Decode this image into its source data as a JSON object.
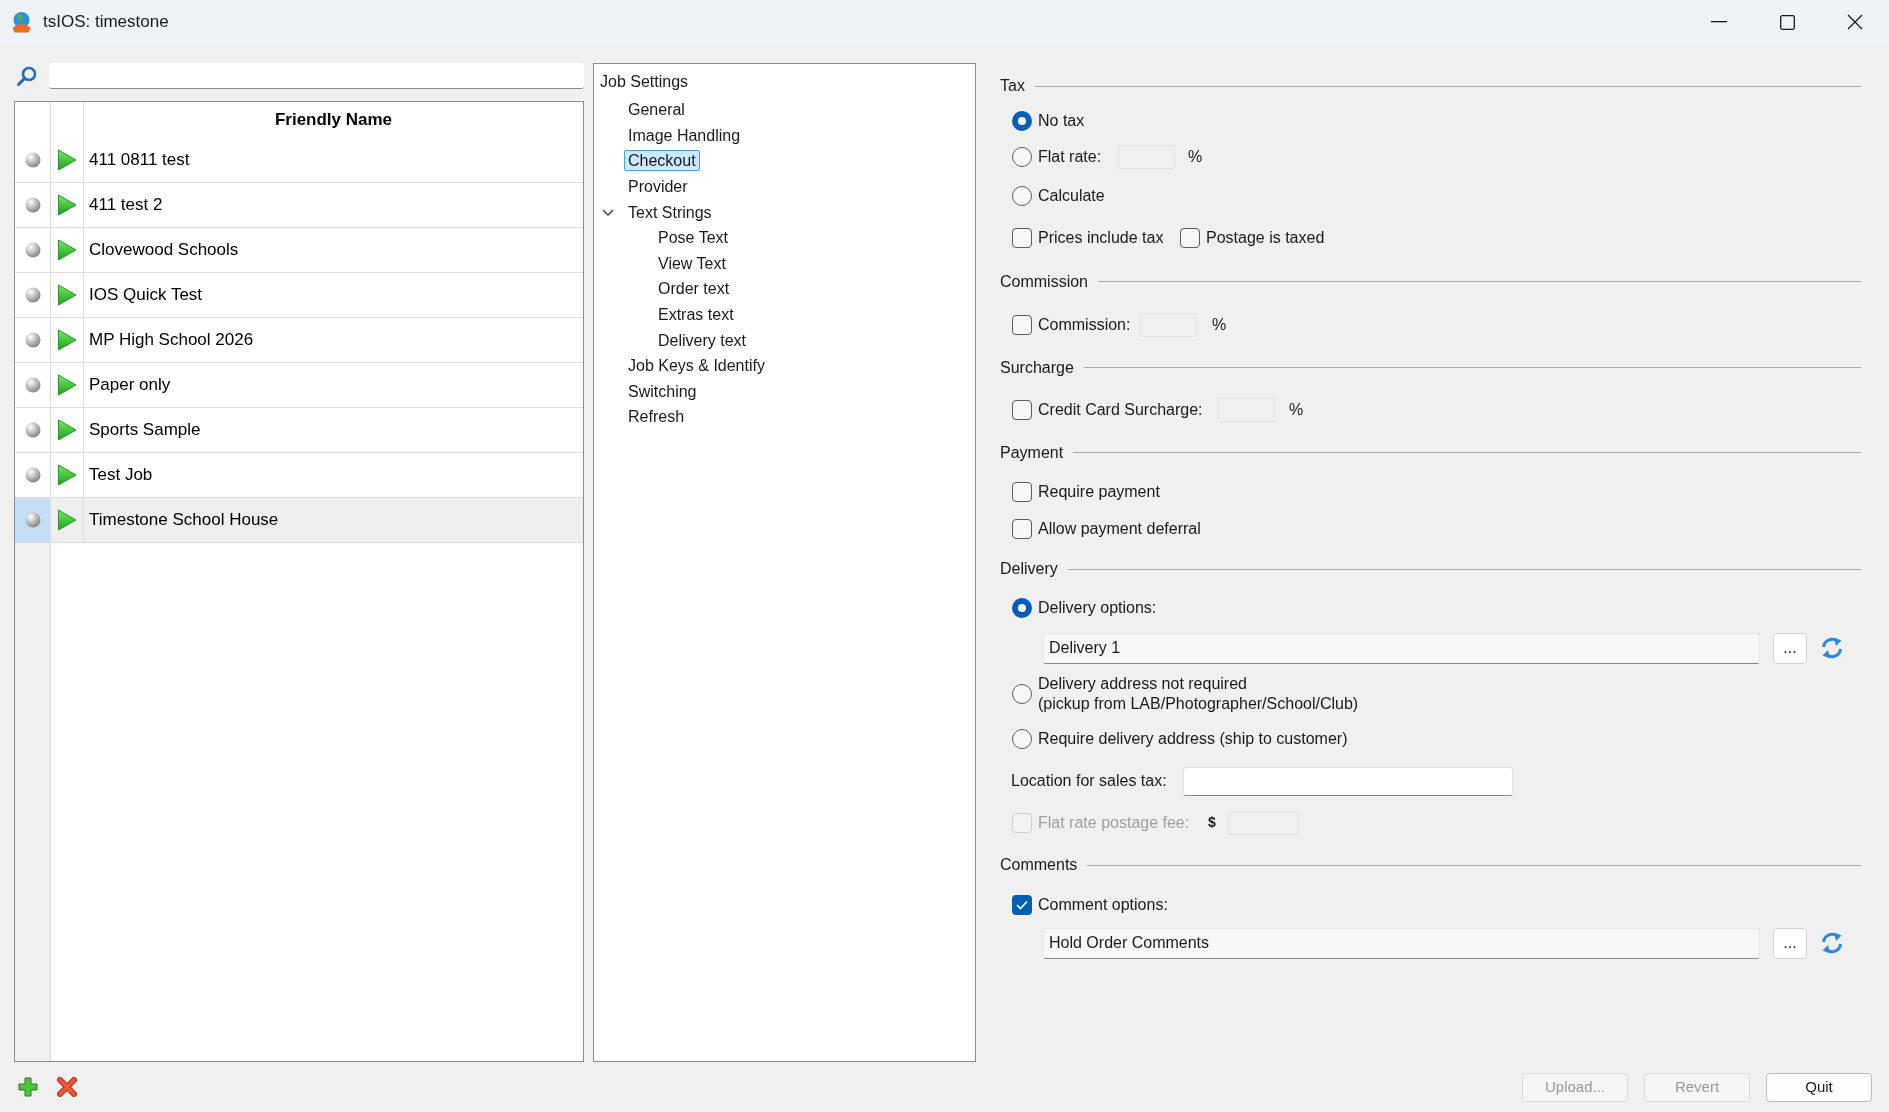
{
  "window": {
    "title": "tsIOS: timestone"
  },
  "jobs": {
    "heading": "Friendly Name",
    "rows": [
      {
        "name": "411 0811 test",
        "selected": false
      },
      {
        "name": "411 test 2",
        "selected": false
      },
      {
        "name": "Clovewood Schools",
        "selected": false
      },
      {
        "name": "IOS Quick Test",
        "selected": false
      },
      {
        "name": "MP High School 2026",
        "selected": false
      },
      {
        "name": "Paper only",
        "selected": false
      },
      {
        "name": "Sports Sample",
        "selected": false
      },
      {
        "name": "Test Job",
        "selected": false
      },
      {
        "name": "Timestone School House",
        "selected": true
      }
    ]
  },
  "settings_tree": {
    "items": [
      {
        "label": "Job Settings",
        "selected": false,
        "children": [
          {
            "label": "General",
            "selected": false
          },
          {
            "label": "Image Handling",
            "selected": false
          },
          {
            "label": "Checkout",
            "selected": true
          },
          {
            "label": "Provider",
            "selected": false
          },
          {
            "label": "Text Strings",
            "selected": false,
            "expanded": true,
            "children": [
              {
                "label": "Pose Text",
                "selected": false
              },
              {
                "label": "View Text",
                "selected": false
              },
              {
                "label": "Order text",
                "selected": false
              },
              {
                "label": "Extras text",
                "selected": false
              },
              {
                "label": "Delivery text",
                "selected": false
              }
            ]
          },
          {
            "label": "Job Keys & Identify",
            "selected": false
          },
          {
            "label": "Switching",
            "selected": false
          },
          {
            "label": "Refresh",
            "selected": false
          }
        ]
      }
    ]
  },
  "tax": {
    "heading": "Tax",
    "options": [
      {
        "label": "No tax",
        "selected": true
      },
      {
        "label": "Flat rate:",
        "selected": false,
        "unit": "%"
      },
      {
        "label": "Calculate",
        "selected": false
      }
    ],
    "checks": [
      {
        "label": "Prices include tax",
        "checked": false
      },
      {
        "label": "Postage is taxed",
        "checked": false
      }
    ]
  },
  "commission": {
    "heading": "Commission",
    "label": "Commission:",
    "checked": false,
    "unit": "%"
  },
  "surcharge": {
    "heading": "Surcharge",
    "label": "Credit Card Surcharge:",
    "checked": false,
    "unit": "%"
  },
  "payment": {
    "heading": "Payment",
    "checks": [
      {
        "label": "Require payment",
        "checked": false
      },
      {
        "label": "Allow payment deferral",
        "checked": false
      }
    ]
  },
  "delivery": {
    "heading": "Delivery",
    "options": [
      {
        "label": "Delivery options:",
        "selected": true,
        "value": "Delivery 1",
        "browse": "..."
      },
      {
        "label": "Delivery address not required\n(pickup from LAB/Photographer/School/Club)",
        "selected": false
      },
      {
        "label": "Require delivery address (ship to customer)",
        "selected": false
      }
    ],
    "location_label": "Location for sales tax:",
    "postage": {
      "label": "Flat rate postage fee:",
      "checked": false,
      "disabled": true,
      "currency": "$"
    }
  },
  "comments": {
    "heading": "Comments",
    "label": "Comment options:",
    "checked": true,
    "value": "Hold Order Comments",
    "browse": "..."
  },
  "footer": {
    "buttons": [
      {
        "label": "Upload...",
        "disabled": true
      },
      {
        "label": "Revert",
        "disabled": true
      },
      {
        "label": "Quit",
        "disabled": false
      }
    ]
  }
}
